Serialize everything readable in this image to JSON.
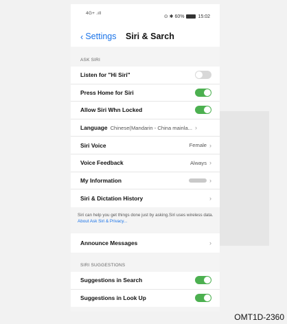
{
  "status_bar": {
    "signal_text": "4G+ ",
    "carrier_icon": "signal-icon",
    "right_text": "⊙ ✱ 60%",
    "time": "15:02"
  },
  "nav": {
    "back_label": "Settings",
    "title": "Siri & Sarch"
  },
  "ask_siri": {
    "header": "ASK SIRI",
    "rows": [
      {
        "label": "Listen for \"Hi  Siri\"",
        "toggle": "off"
      },
      {
        "label": "Press Home for Siri",
        "toggle": "on"
      },
      {
        "label": "Allow Siri Whn Locked",
        "toggle": "on"
      },
      {
        "label": "Language",
        "value": "Chinese(Mandarin - China mainla..."
      },
      {
        "label": "Siri Voice",
        "value": "Female"
      },
      {
        "label": "Voice Feedback",
        "value": "Always"
      },
      {
        "label": "My Information",
        "value": ""
      },
      {
        "label": "Siri & Dictation History",
        "value": ""
      }
    ]
  },
  "footnote": {
    "text": "Siri can help you get things done just by asking.Siri uses wireless data. ",
    "link": "About Ask Siri & Privacy..."
  },
  "announce": {
    "label": "Announce Messages"
  },
  "suggestions": {
    "header": "SIRI SUGGESTIONS",
    "rows": [
      {
        "label": "Suggestions in Search",
        "toggle": "on"
      },
      {
        "label": "Suggestions in Look Up",
        "toggle": "on"
      }
    ]
  },
  "caption": "OMT1D-2360",
  "colors": {
    "accent": "#1a73e8",
    "toggle_on": "#4cb050",
    "toggle_off": "#d8d8d8"
  }
}
